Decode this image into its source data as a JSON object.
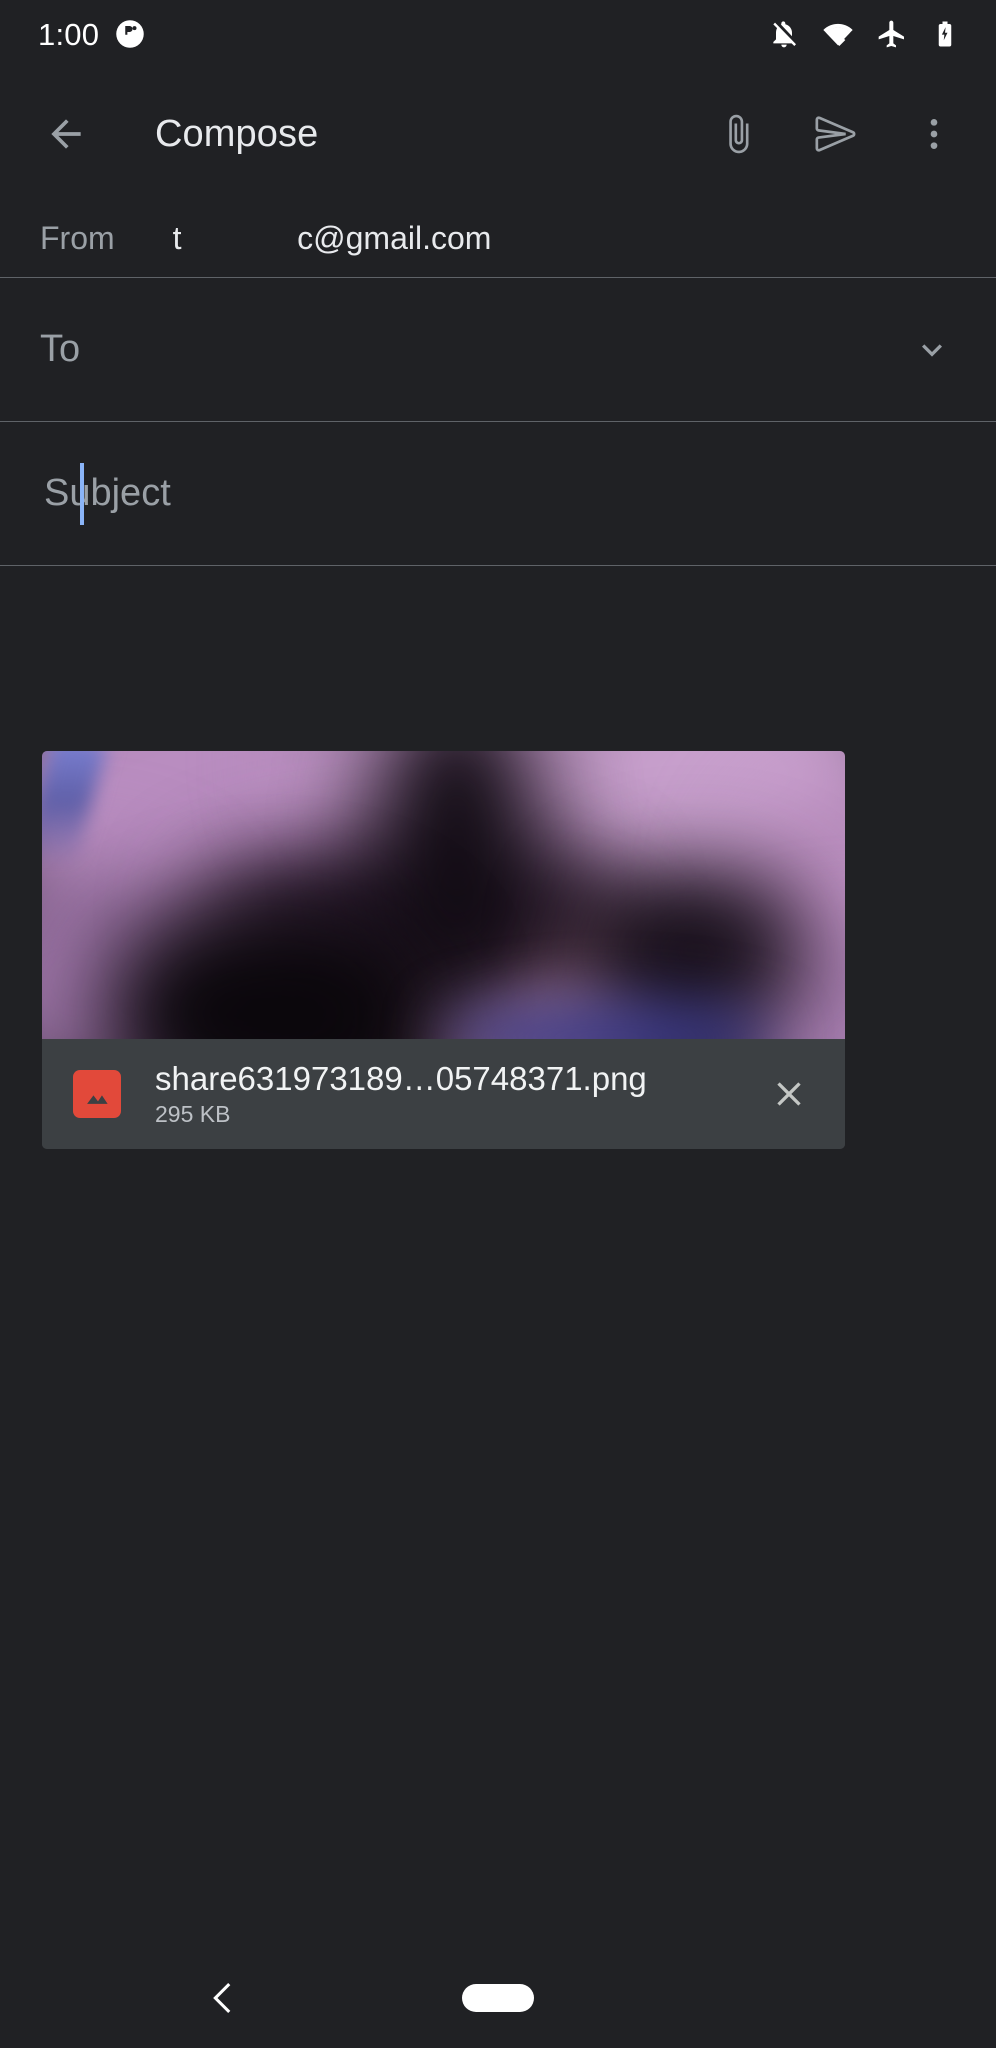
{
  "status_bar": {
    "time": "1:00",
    "icons": [
      {
        "name": "notification-badge-icon"
      },
      {
        "name": "notifications-off-icon"
      },
      {
        "name": "wifi-icon"
      },
      {
        "name": "airplane-mode-icon"
      },
      {
        "name": "battery-charging-icon"
      }
    ]
  },
  "app_bar": {
    "title": "Compose",
    "back_icon": "arrow-back-icon",
    "attach_icon": "paperclip-icon",
    "send_icon": "send-icon",
    "overflow_icon": "more-vert-icon"
  },
  "compose": {
    "from": {
      "label": "From",
      "value": "t             c@gmail.com"
    },
    "to": {
      "placeholder": "To",
      "value": "",
      "expand_icon": "chevron-down-icon"
    },
    "subject": {
      "placeholder": "Subject",
      "value": ""
    },
    "body": {
      "placeholder": "",
      "value": ""
    },
    "attachment": {
      "file_name": "share631973189…05748371.png",
      "file_size": "295 KB",
      "file_type_icon": "image-file-icon",
      "remove_icon": "close-icon"
    }
  },
  "nav_bar": {
    "back_icon": "nav-back-chevron-icon",
    "home_handle": "home-gesture-pill"
  },
  "colors": {
    "background": "#202124",
    "surface": "#3c4043",
    "divider": "#5f6368",
    "text_primary": "#e8eaed",
    "text_secondary": "#9aa0a6",
    "caret": "#8ab4f8",
    "file_icon": "#e2493a"
  }
}
